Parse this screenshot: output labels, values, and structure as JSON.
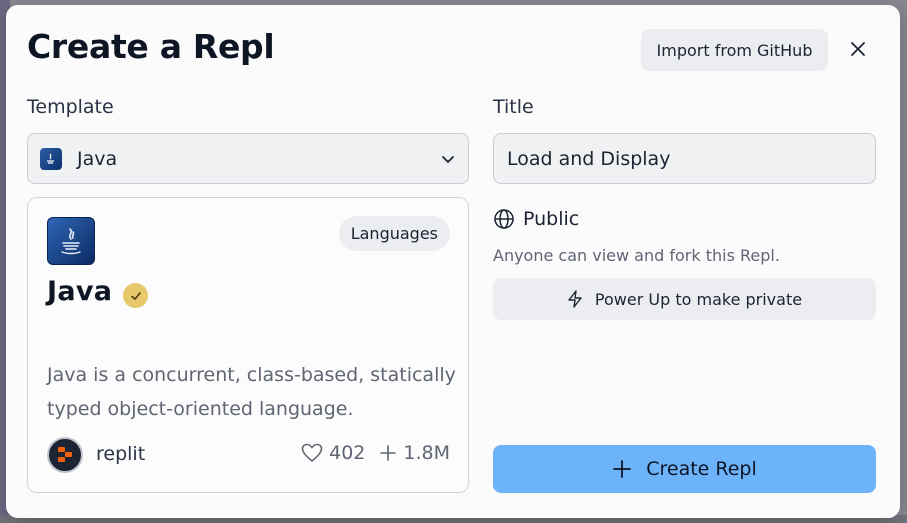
{
  "dialog": {
    "title": "Create a Repl",
    "import_button": "Import from GitHub"
  },
  "template": {
    "label": "Template",
    "selected": "Java"
  },
  "card": {
    "tag": "Languages",
    "name": "Java",
    "description": "Java is a concurrent, class-based, statically typed object-oriented language.",
    "author": "replit",
    "likes": "402",
    "forks": "1.8M"
  },
  "title_field": {
    "label": "Title",
    "value": "Load and Display"
  },
  "visibility": {
    "label": "Public",
    "description": "Anyone can view and fork this Repl.",
    "power_up_button": "Power Up to make private"
  },
  "create_button": "Create Repl",
  "colors": {
    "primary": "#6db3f9",
    "verified": "#e7c96b"
  }
}
